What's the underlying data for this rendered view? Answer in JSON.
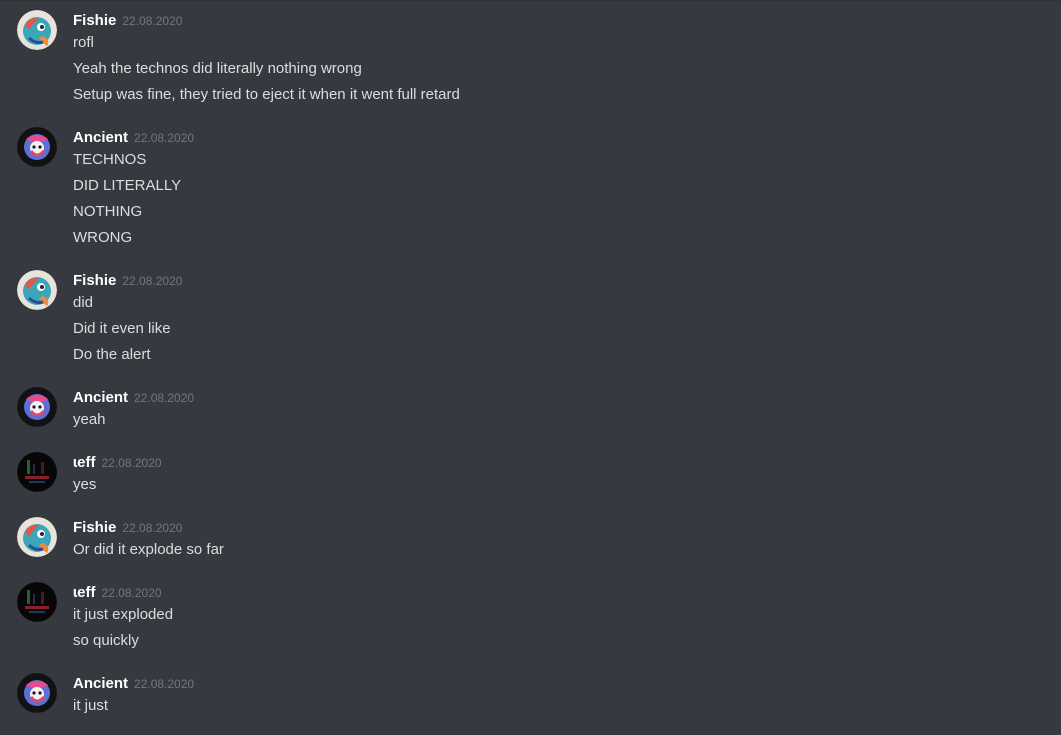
{
  "chat": {
    "groups": [
      {
        "author": "Fishie",
        "timestamp": "22.08.2020",
        "avatar": "fishie-avatar",
        "messages": [
          "rofl",
          "Yeah the technos did literally nothing wrong",
          "Setup was fine, they tried to eject it when it went full retard"
        ]
      },
      {
        "author": "Ancient",
        "timestamp": "22.08.2020",
        "avatar": "ancient-avatar",
        "messages": [
          "TECHNOS",
          "DID LITERALLY",
          "NOTHING",
          "WRONG"
        ]
      },
      {
        "author": "Fishie",
        "timestamp": "22.08.2020",
        "avatar": "fishie-avatar",
        "messages": [
          "did",
          "Did it even like",
          "Do the alert"
        ]
      },
      {
        "author": "Ancient",
        "timestamp": "22.08.2020",
        "avatar": "ancient-avatar",
        "messages": [
          "yeah"
        ]
      },
      {
        "author": "ɩeff",
        "timestamp": "22.08.2020",
        "avatar": "jeff-avatar",
        "messages": [
          "yes"
        ]
      },
      {
        "author": "Fishie",
        "timestamp": "22.08.2020",
        "avatar": "fishie-avatar",
        "messages": [
          "Or did it explode so far"
        ]
      },
      {
        "author": "ɩeff",
        "timestamp": "22.08.2020",
        "avatar": "jeff-avatar",
        "messages": [
          "it just exploded",
          "so quickly"
        ]
      },
      {
        "author": "Ancient",
        "timestamp": "22.08.2020",
        "avatar": "ancient-avatar",
        "messages": [
          "it just"
        ]
      }
    ]
  },
  "colors": {
    "background": "#36393f",
    "username": "#ffffff",
    "timestamp": "#72767d",
    "message": "#dcddde"
  }
}
